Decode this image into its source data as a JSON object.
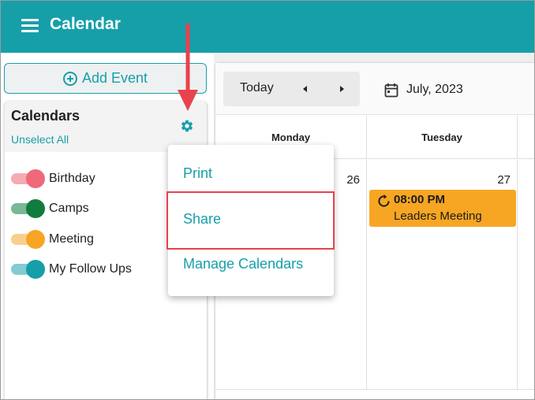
{
  "header": {
    "title": "Calendar",
    "menu_icon": "hamburger-icon",
    "color": "#169fa9"
  },
  "sidebar": {
    "add_event_label": "Add Event",
    "add_event_icon": "plus-circle-icon",
    "calendars_heading": "Calendars",
    "unselect_all": "Unselect All",
    "settings_icon": "gear-icon",
    "calendars": [
      {
        "label": "Birthday",
        "on": true,
        "knob_color": "#f0697a",
        "track_color": "#f6aab3"
      },
      {
        "label": "Camps",
        "on": true,
        "knob_color": "#127c3e",
        "track_color": "#7ab795"
      },
      {
        "label": "Meeting",
        "on": true,
        "knob_color": "#f7a623",
        "track_color": "#f9cf8d"
      },
      {
        "label": "My Follow Ups",
        "on": true,
        "knob_color": "#169fa9",
        "track_color": "#83cbd0"
      }
    ]
  },
  "toolbar": {
    "today_label": "Today",
    "prev_icon": "triangle-left-icon",
    "next_icon": "triangle-right-icon",
    "calendar_icon": "calendar-icon",
    "month_label": "July, 2023"
  },
  "week": {
    "days": [
      {
        "name": "Monday",
        "date": "26"
      },
      {
        "name": "Tuesday",
        "date": "27"
      }
    ]
  },
  "event": {
    "icon": "recurring-icon",
    "time": "08:00 PM",
    "title": "Leaders Meeting",
    "color": "#f7a623"
  },
  "menu": {
    "items": [
      {
        "label": "Print"
      },
      {
        "label": "Share",
        "highlighted": true
      },
      {
        "label": "Manage Calendars"
      }
    ],
    "highlight_color": "#e8424e"
  }
}
